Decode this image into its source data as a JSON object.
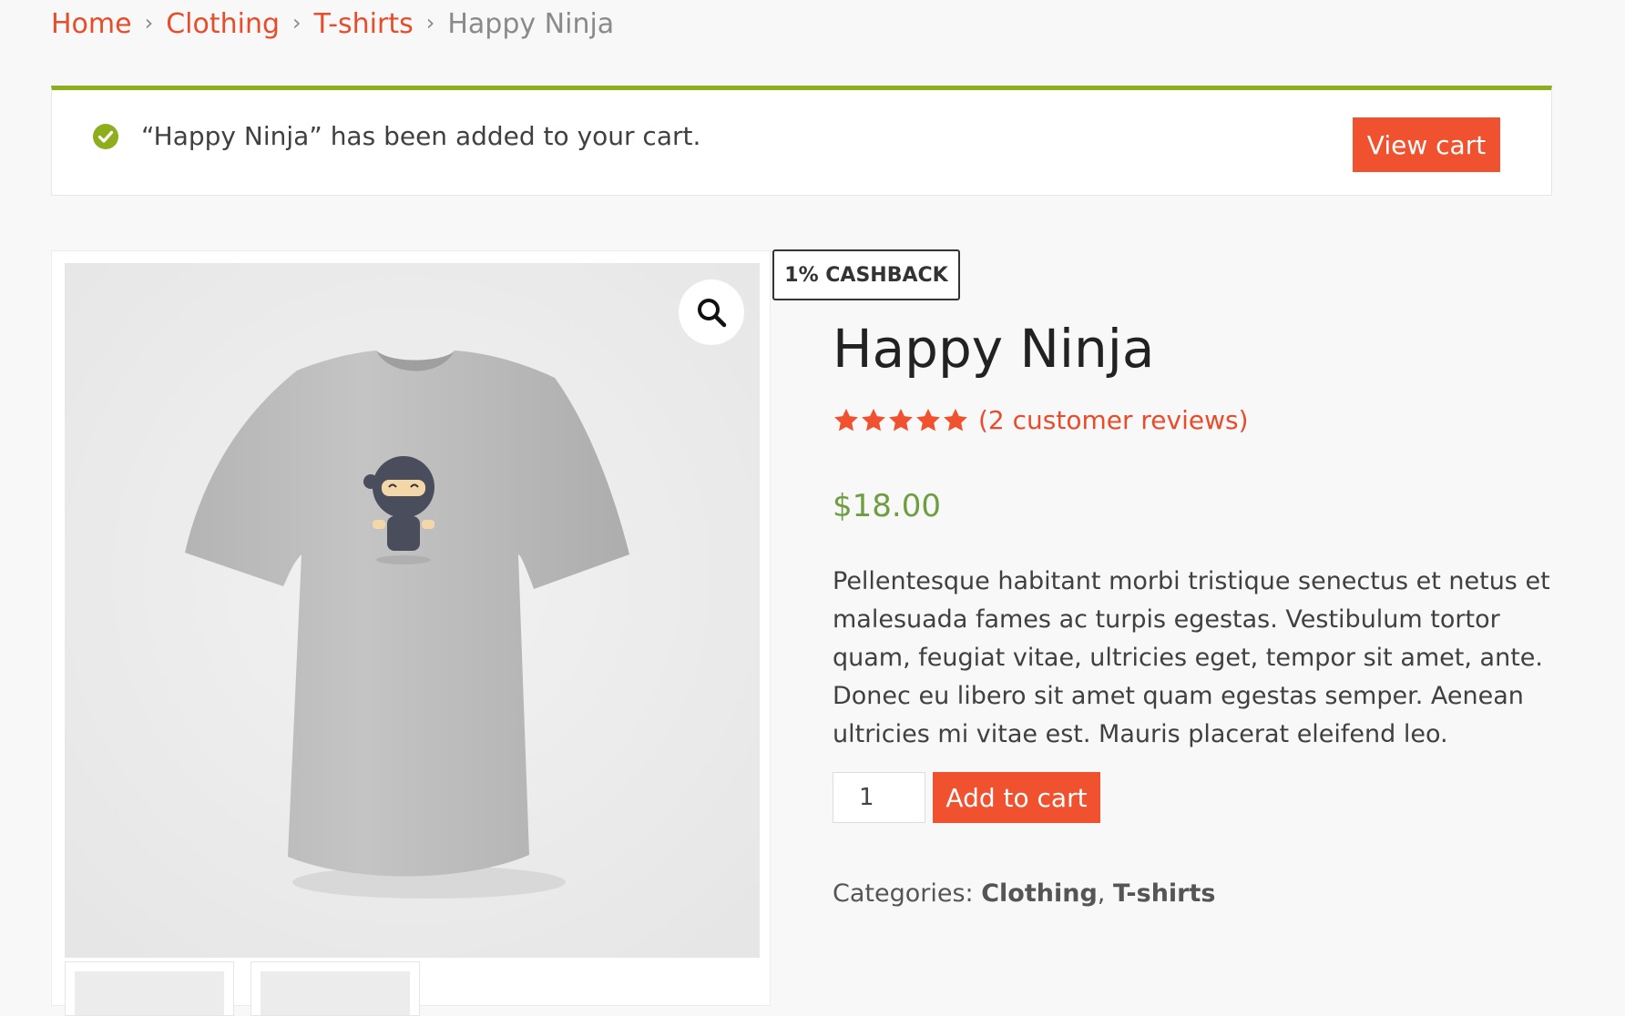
{
  "breadcrumb": {
    "items": [
      "Home",
      "Clothing",
      "T-shirts"
    ],
    "current": "Happy Ninja"
  },
  "notice": {
    "message": "“Happy Ninja” has been added to your cart.",
    "button_label": "View cart",
    "icon": "check-circle-icon",
    "accent_color": "#8fae1b"
  },
  "gallery": {
    "zoom_icon": "magnifier-icon",
    "image": "t-shirt-with-ninja-print"
  },
  "badge": {
    "label": "1% CASHBACK"
  },
  "product": {
    "title": "Happy Ninja",
    "rating": 5,
    "rating_max": 5,
    "review_link": "(2 customer reviews)",
    "price": "$18.00",
    "price_color": "#6e9e3f",
    "description": "Pellentesque habitant morbi tristique senectus et netus et malesuada fames ac turpis egestas. Vestibulum tortor quam, feugiat vitae, ultricies eget, tempor sit amet, ante. Donec eu libero sit amet quam egestas semper. Aenean ultricies mi vitae est. Mauris placerat eleifend leo.",
    "quantity": "1",
    "add_to_cart_label": "Add to cart",
    "accent_color": "#f0522f"
  },
  "meta": {
    "categories_label": "Categories:",
    "categories": [
      "Clothing",
      "T-shirts"
    ],
    "separator": ","
  }
}
